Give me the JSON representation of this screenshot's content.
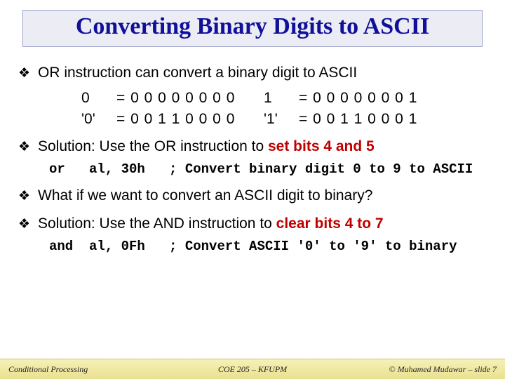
{
  "title": "Converting Binary Digits to ASCII",
  "bullets": {
    "b1": "OR instruction can convert a binary digit to ASCII",
    "b2_pre": "Solution: Use the OR instruction to ",
    "b2_em": "set bits 4 and 5",
    "b3": "What if we want to convert an ASCII digit to binary?",
    "b4_pre": "Solution: Use the AND instruction to ",
    "b4_em": "clear bits 4 to 7"
  },
  "bits": {
    "r1": {
      "c1": "0",
      "c2": "= 0 0 0 0 0 0 0 0",
      "c3": "1",
      "c4": "= 0 0 0 0 0 0 0 1"
    },
    "r2": {
      "c1": "'0'",
      "c2": "= 0 0 1 1 0 0 0 0",
      "c3": "'1'",
      "c4": "= 0 0 1 1 0 0 0 1"
    }
  },
  "code": {
    "or": "or   al, 30h   ; Convert binary digit 0 to 9 to ASCII",
    "and": "and  al, 0Fh   ; Convert ASCII '0' to '9' to binary"
  },
  "footer": {
    "left": "Conditional Processing",
    "center": "COE 205 – KFUPM",
    "right": "© Muhamed Mudawar – slide 7"
  }
}
